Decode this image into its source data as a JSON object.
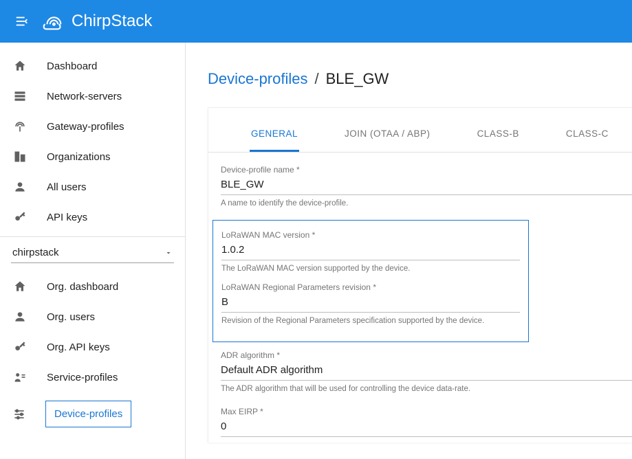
{
  "app": {
    "name": "ChirpStack"
  },
  "sidebar": {
    "main": [
      {
        "label": "Dashboard",
        "icon": "home"
      },
      {
        "label": "Network-servers",
        "icon": "servers"
      },
      {
        "label": "Gateway-profiles",
        "icon": "antenna"
      },
      {
        "label": "Organizations",
        "icon": "org"
      },
      {
        "label": "All users",
        "icon": "user"
      },
      {
        "label": "API keys",
        "icon": "key"
      }
    ],
    "org_selector": {
      "value": "chirpstack"
    },
    "org": [
      {
        "label": "Org. dashboard",
        "icon": "home"
      },
      {
        "label": "Org. users",
        "icon": "user"
      },
      {
        "label": "Org. API keys",
        "icon": "key"
      },
      {
        "label": "Service-profiles",
        "icon": "service"
      },
      {
        "label": "Device-profiles",
        "icon": "tune",
        "active": true
      }
    ]
  },
  "breadcrumb": {
    "parent": "Device-profiles",
    "current": "BLE_GW"
  },
  "tabs": [
    {
      "label": "GENERAL",
      "active": true
    },
    {
      "label": "JOIN (OTAA / ABP)"
    },
    {
      "label": "CLASS-B"
    },
    {
      "label": "CLASS-C"
    }
  ],
  "form": {
    "name": {
      "label": "Device-profile name *",
      "value": "BLE_GW",
      "help": "A name to identify the device-profile."
    },
    "mac": {
      "label": "LoRaWAN MAC version *",
      "value": "1.0.2",
      "help": "The LoRaWAN MAC version supported by the device."
    },
    "regrev": {
      "label": "LoRaWAN Regional Parameters revision *",
      "value": "B",
      "help": "Revision of the Regional Parameters specification supported by the device."
    },
    "adr": {
      "label": "ADR algorithm *",
      "value": "Default ADR algorithm",
      "help": "The ADR algorithm that will be used for controlling the device data-rate."
    },
    "eirp": {
      "label": "Max EIRP *",
      "value": "0"
    }
  }
}
